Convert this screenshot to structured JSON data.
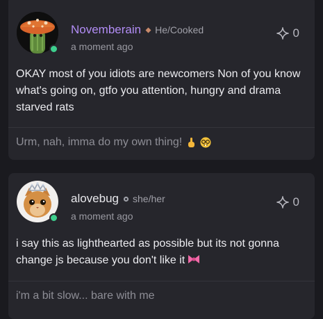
{
  "posts": [
    {
      "username": "Novemberain",
      "username_color": "#b28df5",
      "badge_icon": "small-flair-icon",
      "pronouns": "He/Cooked",
      "timestamp": "a moment ago",
      "star_count": "0",
      "body": "OKAY most of you idiots are newcomers Non of you know what's going on, gtfo you attention, hungry and drama starved rats",
      "reply_preview": "Urm, nah, imma do my own thing!",
      "reply_emojis": [
        "pointing-up-hand-emoji",
        "nerd-face-emoji"
      ],
      "avatar": "mushroom-cactus-avatar",
      "online": true
    },
    {
      "username": "alovebug",
      "username_color": "#e8e8ec",
      "badge_icon": "settings-badge-icon",
      "pronouns": "she/her",
      "timestamp": "a moment ago",
      "star_count": "0",
      "body": "i say this as lighthearted as possible but its not gonna change js because you don't like it",
      "body_emoji": "pink-bow-emoji",
      "reply_preview": "i'm a bit slow... bare with me",
      "avatar": "kitten-tiara-avatar",
      "online": true
    }
  ]
}
